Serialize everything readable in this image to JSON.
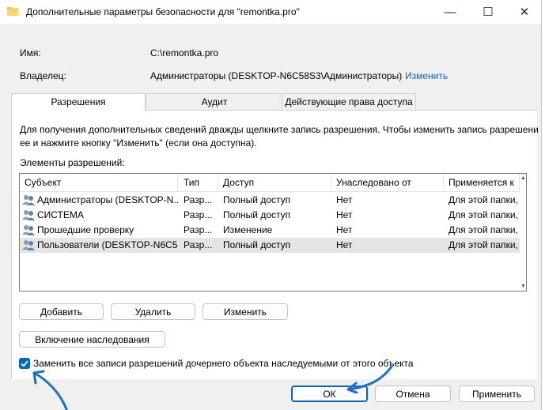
{
  "window": {
    "title": "Дополнительные параметры безопасности  для \"remontka.pro\"",
    "minimize": "—",
    "maximize": "☐",
    "close": "✕"
  },
  "info": {
    "name_label": "Имя:",
    "name_value": "C:\\remontka.pro",
    "owner_label": "Владелец:",
    "owner_value": "Администраторы (DESKTOP-N6C58S3\\Администраторы)",
    "change_link": "Изменить"
  },
  "tabs": [
    {
      "label": "Разрешения",
      "active": true
    },
    {
      "label": "Аудит",
      "active": false
    },
    {
      "label": "Действующие права доступа",
      "active": false
    }
  ],
  "panel": {
    "description": "Для получения дополнительных сведений дважды щелкните запись разрешения. Чтобы изменить запись разрешени",
    "description2": "ее и нажмите кнопку \"Изменить\" (если она доступна).",
    "elements_label": "Элементы разрешений:"
  },
  "table": {
    "headers": [
      "Субъект",
      "Тип",
      "Доступ",
      "Унаследовано от",
      "Применяется к"
    ],
    "rows": [
      [
        "Администраторы (DESKTOP-N...",
        "Разр...",
        "Полный доступ",
        "Нет",
        "Для этой папки, ее"
      ],
      [
        "СИСТЕМА",
        "Разр...",
        "Полный доступ",
        "Нет",
        "Для этой папки, ее"
      ],
      [
        "Прошедшие проверку",
        "Разр...",
        "Изменение",
        "Нет",
        "Для этой папки, ее"
      ],
      [
        "Пользователи (DESKTOP-N6C5...",
        "Разр...",
        "Полный доступ",
        "Нет",
        "Для этой папки, ее"
      ]
    ]
  },
  "buttons": {
    "add": "Добавить",
    "remove": "Удалить",
    "edit": "Изменить",
    "enable_inheritance": "Включение наследования",
    "replace_checkbox_label": "Заменить все записи разрешений дочернего объекта наследуемыми от этого объекта",
    "ok": "ОК",
    "cancel": "Отмена",
    "apply": "Применить"
  },
  "state": {
    "replace_checked": true
  },
  "colors": {
    "accent": "#0067c0",
    "annotation_arrow": "#1a73c8"
  }
}
